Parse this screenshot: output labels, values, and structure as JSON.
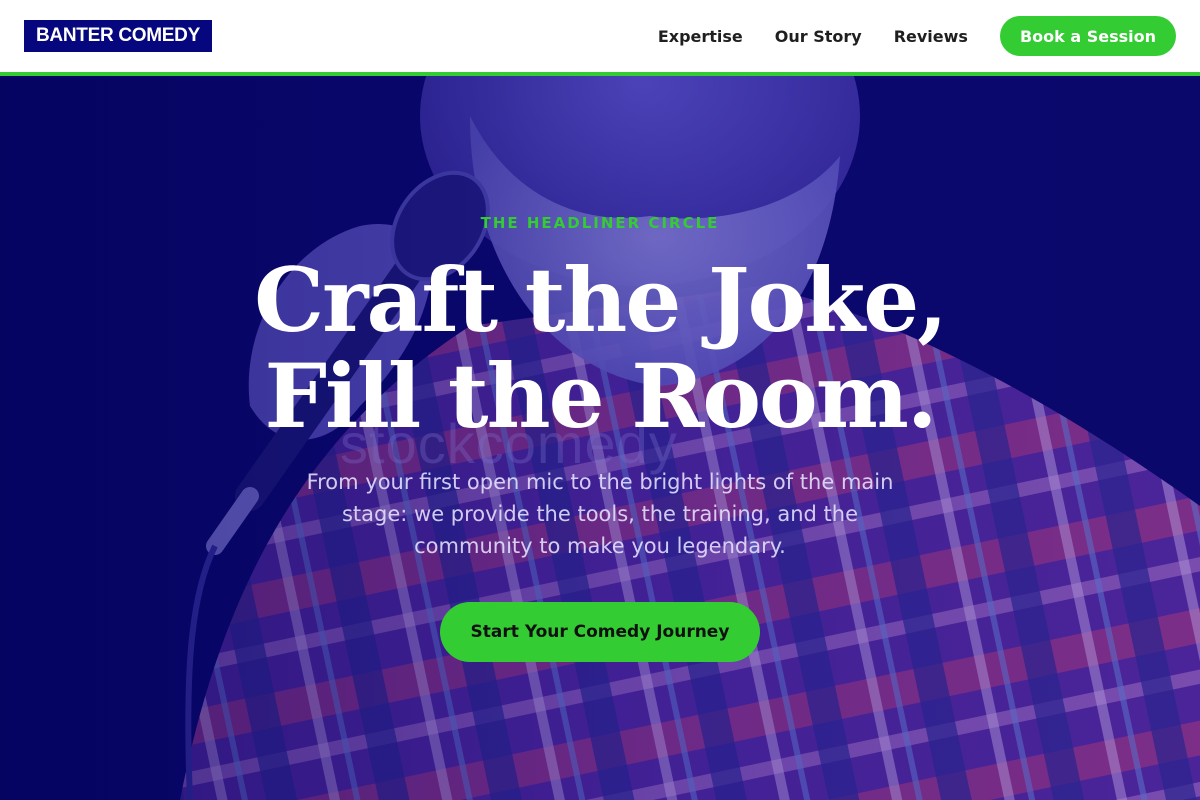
{
  "header": {
    "logo": "BANTER COMEDY",
    "nav": [
      {
        "label": "Expertise"
      },
      {
        "label": "Our Story"
      },
      {
        "label": "Reviews"
      }
    ],
    "cta_label": "Book a Session"
  },
  "hero": {
    "eyebrow": "THE HEADLINER CIRCLE",
    "headline_line1": "Craft the Joke,",
    "headline_line2": "Fill the Room.",
    "subtext": "From your first open mic to the bright lights of the main stage: we provide the tools, the training, and the community to make you legendary.",
    "cta_label": "Start Your Comedy Journey",
    "watermark": "stockcomedy"
  },
  "colors": {
    "brand_navy": "#06067e",
    "accent_green": "#33cc33",
    "hero_overlay": "#05045e"
  }
}
